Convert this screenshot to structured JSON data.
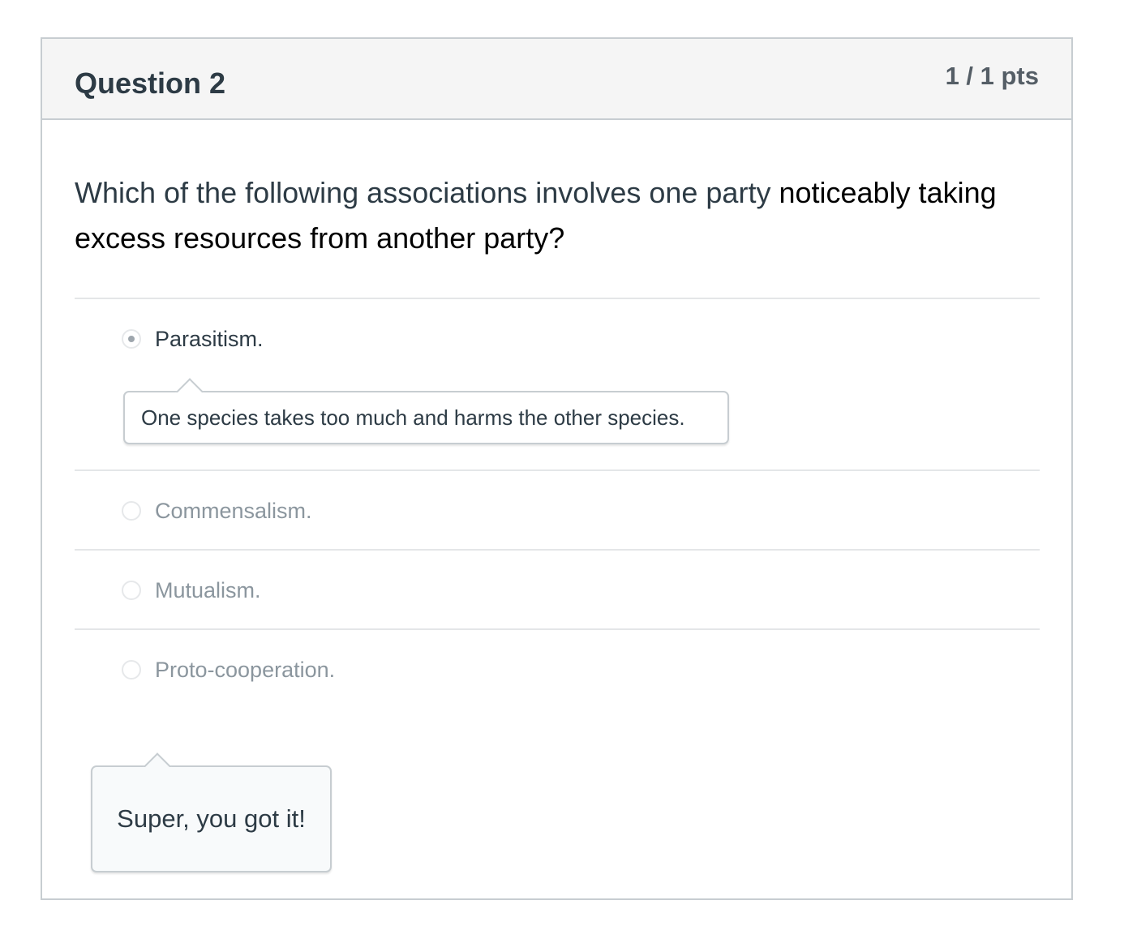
{
  "question": {
    "title": "Question 2",
    "points": "1 / 1 pts",
    "text_part1": "Which of the following associations involves one party ",
    "text_part2": "noticeably taking excess resources from another party?"
  },
  "answers": [
    {
      "label": "Parasitism.",
      "selected": true
    },
    {
      "label": "Commensalism.",
      "selected": false
    },
    {
      "label": "Mutualism.",
      "selected": false
    },
    {
      "label": "Proto-cooperation.",
      "selected": false
    }
  ],
  "answer_feedback": "One species takes too much and harms the other species.",
  "result_feedback": "Super, you got it!"
}
